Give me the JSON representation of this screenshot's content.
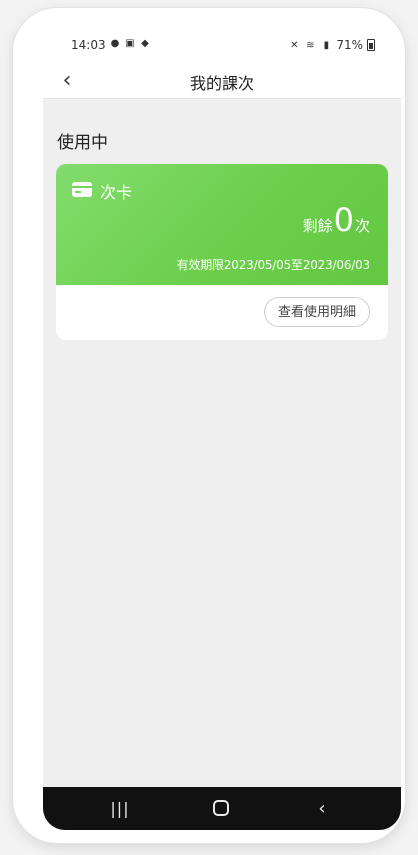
{
  "status_bar": {
    "time": "14:03",
    "left_icons": [
      "chat-icon",
      "image-icon",
      "message-icon"
    ],
    "battery_percent": "71%"
  },
  "header": {
    "back_glyph": "‹",
    "title": "我的課次"
  },
  "section": {
    "title": "使用中"
  },
  "card": {
    "name": "次卡",
    "remaining_label": "剩餘",
    "remaining_count": "0",
    "remaining_unit": "次",
    "validity": "有效期限2023/05/05至2023/06/03",
    "details_button": "查看使用明細",
    "accent_color": "#6ccf4b"
  },
  "system_nav": {
    "recents_glyph": "|||",
    "back_glyph": "‹"
  }
}
